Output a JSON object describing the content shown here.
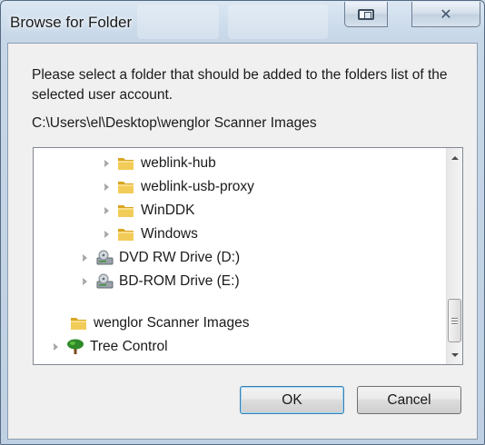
{
  "window": {
    "title": "Browse for Folder",
    "controls": [
      {
        "name": "restore",
        "icon": "restore-icon"
      },
      {
        "name": "close",
        "icon": "close-icon",
        "glyph": "✕"
      }
    ]
  },
  "prompt": "Please select a folder that should be added to the folders list of the selected user account.",
  "selected_path": "C:\\Users\\el\\Desktop\\wenglor Scanner Images",
  "tree": {
    "items": [
      {
        "label": "weblink-hub",
        "icon": "folder-icon",
        "expandable": true
      },
      {
        "label": "weblink-usb-proxy",
        "icon": "folder-icon",
        "expandable": true
      },
      {
        "label": "WinDDK",
        "icon": "folder-icon",
        "expandable": true
      },
      {
        "label": "Windows",
        "icon": "folder-icon",
        "expandable": true
      },
      {
        "label": "DVD RW Drive (D:)",
        "icon": "dvd-drive-icon",
        "expandable": true
      },
      {
        "label": "BD-ROM Drive (E:)",
        "icon": "bd-drive-icon",
        "expandable": true
      },
      {
        "label": "wenglor Scanner Images",
        "icon": "folder-icon",
        "expandable": false
      },
      {
        "label": "Tree Control",
        "icon": "tree-icon",
        "expandable": true
      }
    ]
  },
  "buttons": {
    "ok": "OK",
    "cancel": "Cancel"
  },
  "colors": {
    "folder": "#e8b93a",
    "tree_green": "#2f8a2a",
    "accent_border": "#3c7fb1"
  }
}
